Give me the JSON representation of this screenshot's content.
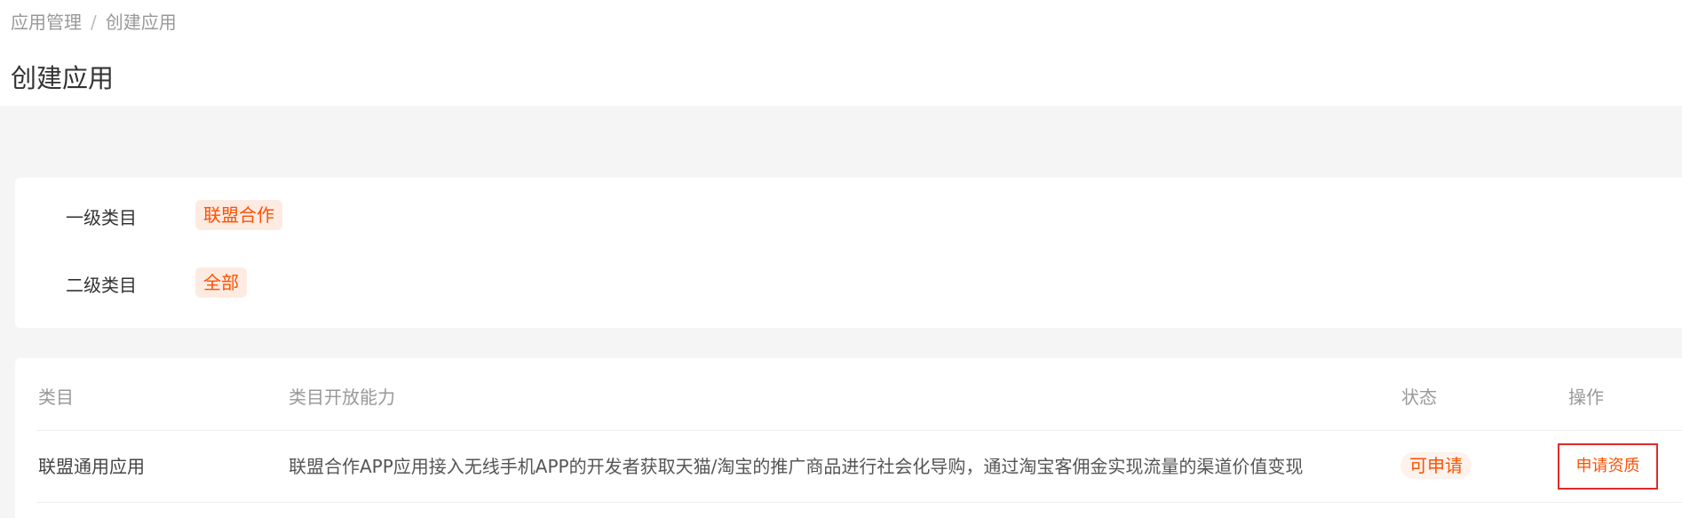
{
  "breadcrumb": {
    "items": [
      "应用管理",
      "创建应用"
    ],
    "separator": "/"
  },
  "page": {
    "title": "创建应用"
  },
  "filters": [
    {
      "label": "一级类目",
      "selected": "联盟合作"
    },
    {
      "label": "二级类目",
      "selected": "全部"
    }
  ],
  "table": {
    "headers": {
      "category": "类目",
      "capability": "类目开放能力",
      "status": "状态",
      "action": "操作"
    },
    "rows": [
      {
        "category": "联盟通用应用",
        "capability": "联盟合作APP应用接入无线手机APP的开发者获取天猫/淘宝的推广商品进行社会化导购，通过淘宝客佣金实现流量的渠道价值变现",
        "status": "可申请",
        "action": "申请资质"
      }
    ]
  },
  "colors": {
    "accent": "#ff5000",
    "tag_bg": "#fdebe2",
    "page_bg": "#f5f5f5",
    "highlight_border": "#e12a2a"
  }
}
